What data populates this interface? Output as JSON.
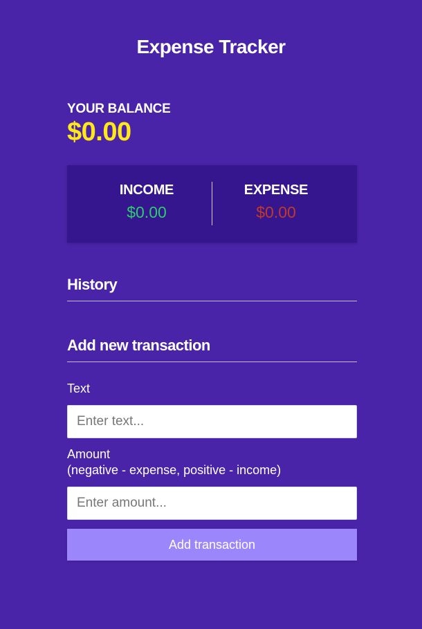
{
  "header": {
    "title": "Expense Tracker"
  },
  "balance": {
    "label": "YOUR BALANCE",
    "amount": "$0.00"
  },
  "summary": {
    "income_label": "INCOME",
    "income_amount": "$0.00",
    "expense_label": "EXPENSE",
    "expense_amount": "$0.00"
  },
  "history": {
    "title": "History"
  },
  "add_transaction": {
    "title": "Add new transaction",
    "text_label": "Text",
    "text_placeholder": "Enter text...",
    "amount_label": "Amount",
    "amount_hint": "(negative - expense, positive - income)",
    "amount_placeholder": "Enter amount...",
    "submit_label": "Add transaction"
  },
  "colors": {
    "background": "#4a24a8",
    "panel": "#35168f",
    "balance": "#ffe81a",
    "income": "#2ecc71",
    "expense": "#c0392b",
    "button": "#9b87fb"
  }
}
